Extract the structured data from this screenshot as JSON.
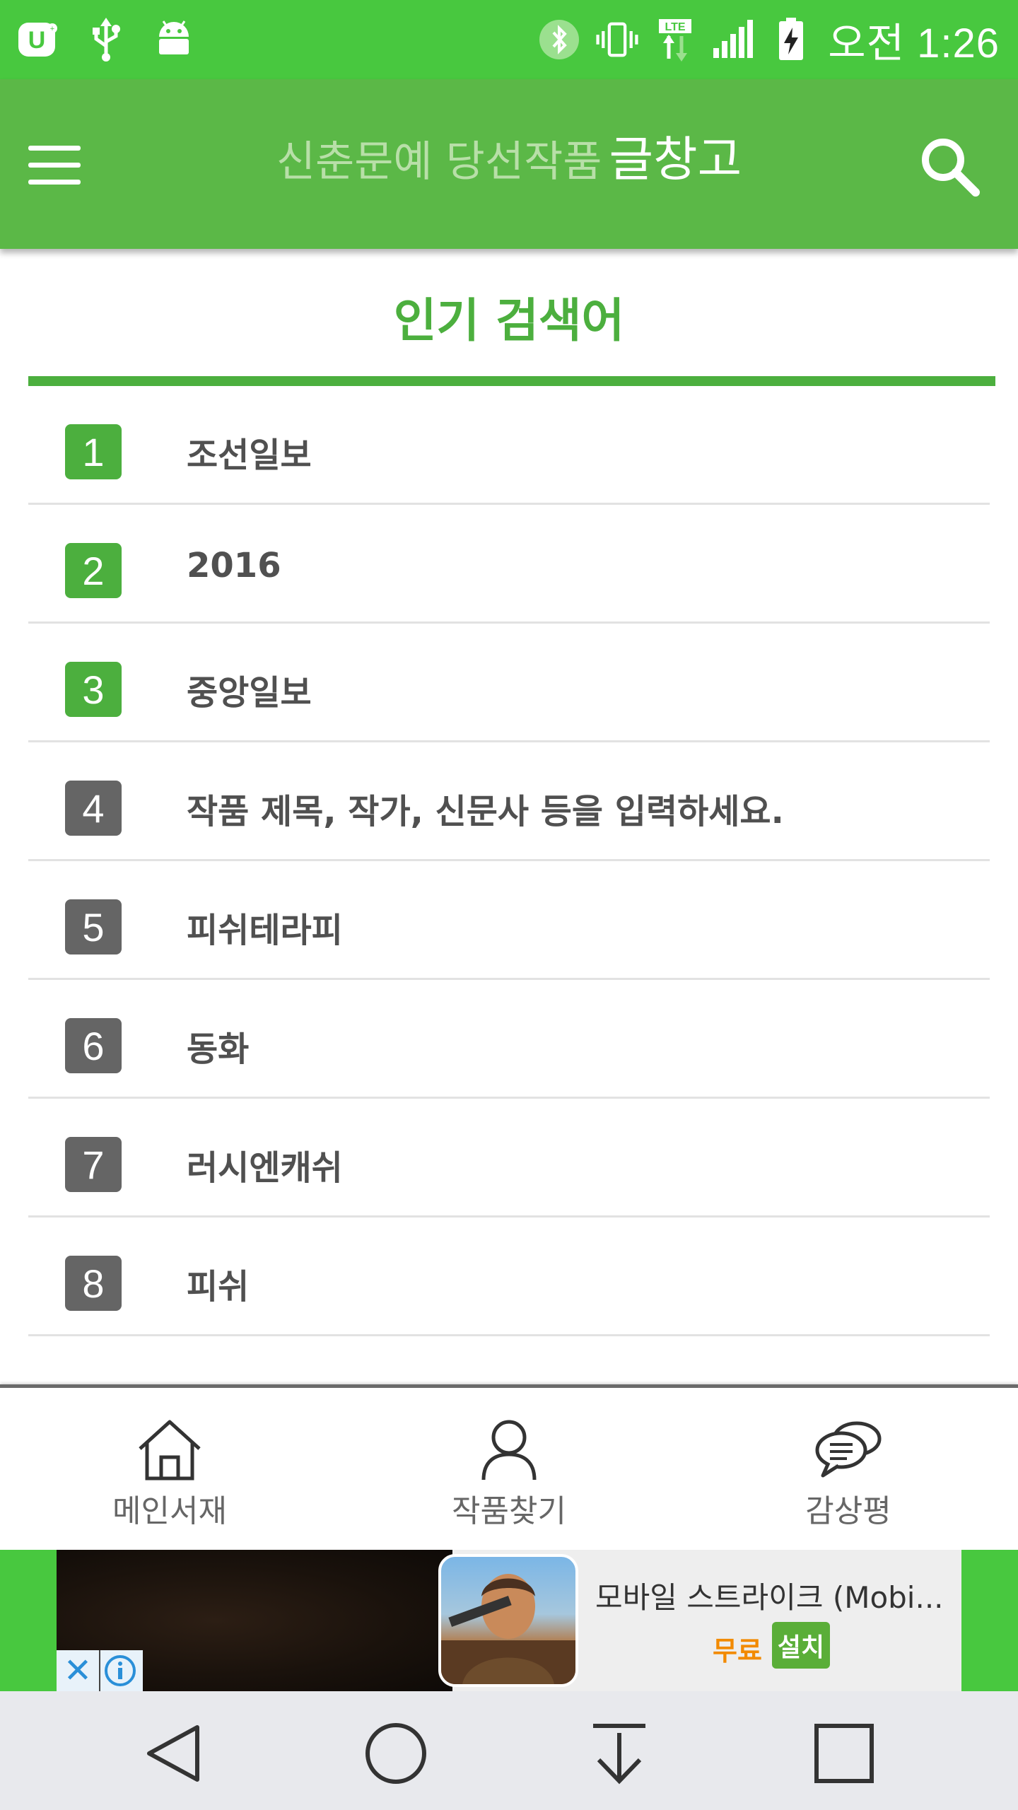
{
  "status_bar": {
    "time": "오전 1:26",
    "icons": [
      "u-plus-icon",
      "usb-icon",
      "android-icon",
      "bluetooth-icon",
      "vibrate-icon",
      "lte-data-icon",
      "signal-icon",
      "battery-charging-icon"
    ]
  },
  "app_bar": {
    "title_light": "신춘문예 당선작품",
    "title_bold": "글창고",
    "menu_icon": "hamburger-menu-icon",
    "search_icon": "search-icon"
  },
  "popular": {
    "title": "인기 검색어",
    "items": [
      {
        "rank": "1",
        "text": "조선일보"
      },
      {
        "rank": "2",
        "text": "2016"
      },
      {
        "rank": "3",
        "text": "중앙일보"
      },
      {
        "rank": "4",
        "text": "작품 제목, 작가, 신문사 등을 입력하세요."
      },
      {
        "rank": "5",
        "text": "피쉬테라피"
      },
      {
        "rank": "6",
        "text": "동화"
      },
      {
        "rank": "7",
        "text": "러시엔캐쉬"
      },
      {
        "rank": "8",
        "text": "피쉬"
      }
    ],
    "colors": {
      "top3": "#4caf3e",
      "rest": "#656565"
    }
  },
  "bottom_nav": {
    "items": [
      {
        "label": "메인서재",
        "icon": "home-icon"
      },
      {
        "label": "작품찾기",
        "icon": "person-icon"
      },
      {
        "label": "감상평",
        "icon": "chat-bubbles-icon"
      }
    ]
  },
  "ad": {
    "title": "모바일 스트라이크 (Mobi...",
    "price": "무료",
    "install": "설치",
    "close_icon": "close-icon",
    "info_icon": "info-icon"
  },
  "system_nav": {
    "icons": [
      "back-icon",
      "home-circle-icon",
      "download-arrow-icon",
      "recents-icon"
    ]
  },
  "colors": {
    "status_bar": "#48c83f",
    "app_bar": "#5bb847",
    "accent": "#4caf3e"
  }
}
